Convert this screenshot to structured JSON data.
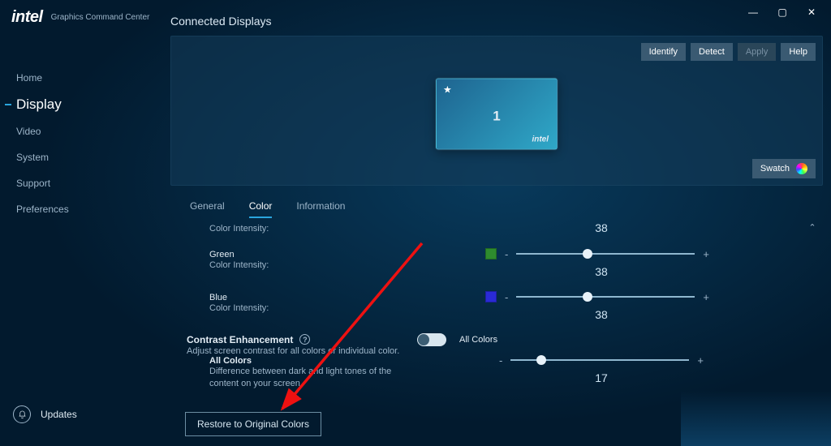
{
  "app": {
    "brand": "intel",
    "subtitle": "Graphics Command Center"
  },
  "window": {
    "min": "—",
    "max": "▢",
    "close": "✕"
  },
  "sidebar": {
    "items": [
      {
        "label": "Home"
      },
      {
        "label": "Display"
      },
      {
        "label": "Video"
      },
      {
        "label": "System"
      },
      {
        "label": "Support"
      },
      {
        "label": "Preferences"
      }
    ],
    "active_index": 1,
    "updates_label": "Updates"
  },
  "page": {
    "title": "Connected Displays",
    "btn_identify": "Identify",
    "btn_detect": "Detect",
    "btn_apply": "Apply",
    "btn_help": "Help",
    "btn_swatch": "Swatch",
    "monitor": {
      "index": "1",
      "brand": "intel"
    },
    "tabs": [
      {
        "label": "General"
      },
      {
        "label": "Color"
      },
      {
        "label": "Information"
      }
    ],
    "active_tab_index": 1
  },
  "color": {
    "rows": [
      {
        "channel": "",
        "sub": "Color Intensity:",
        "swatch": "",
        "value": "38",
        "thumb_pct": 40
      },
      {
        "channel": "Green",
        "sub": "Color Intensity:",
        "swatch": "#2e8b2e",
        "value": "38",
        "thumb_pct": 40
      },
      {
        "channel": "Blue",
        "sub": "Color Intensity:",
        "swatch": "#2a2ad6",
        "value": "38",
        "thumb_pct": 40
      }
    ],
    "contrast_header": "Contrast Enhancement",
    "contrast_desc": "Adjust screen contrast for all colors or individual color.",
    "toggle_label": "All Colors",
    "toggle_on": false,
    "allcolors": {
      "label": "All Colors",
      "desc": "Difference between dark and light tones of the content on your screen",
      "value": "17",
      "thumb_pct": 17
    },
    "restore_label": "Restore to Original Colors",
    "minus": "-",
    "plus": "+"
  }
}
